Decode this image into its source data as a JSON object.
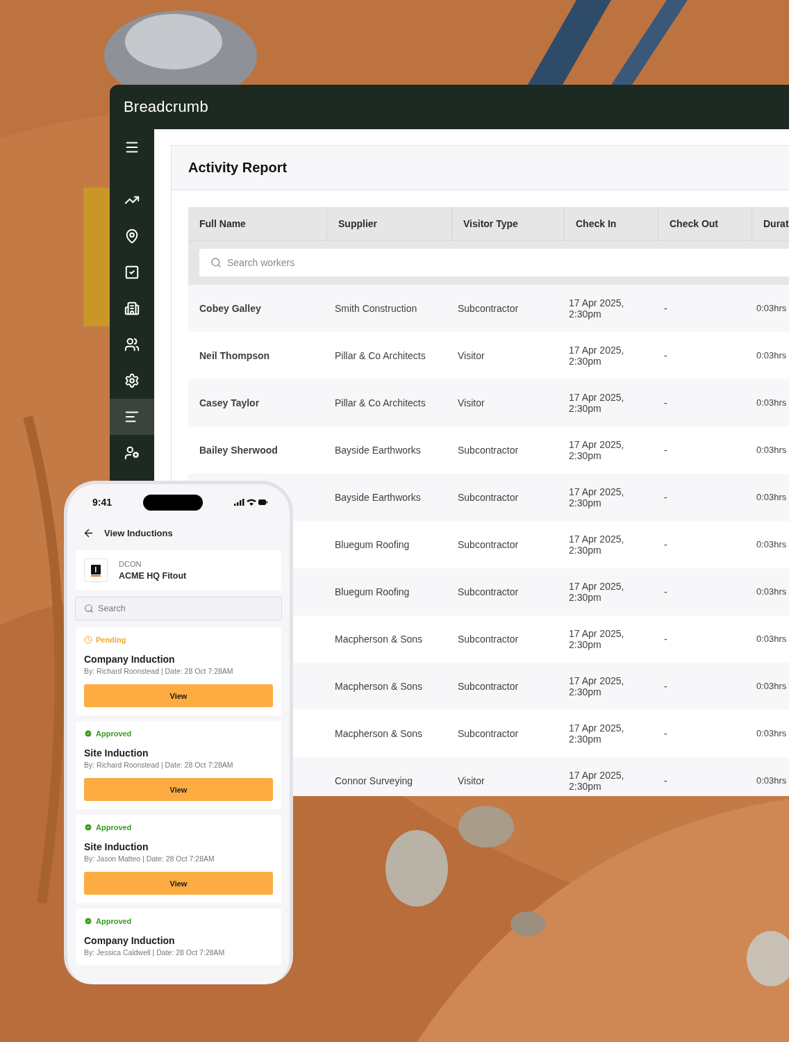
{
  "app": {
    "logo": "Breadcrumb"
  },
  "sidebar": {
    "items": [
      {
        "selected": false
      },
      {
        "selected": false
      },
      {
        "selected": false
      },
      {
        "selected": false
      },
      {
        "selected": false
      },
      {
        "selected": false
      },
      {
        "selected": false
      },
      {
        "selected": true
      },
      {
        "selected": false
      }
    ]
  },
  "report": {
    "title": "Activity Report",
    "columns": [
      "Full Name",
      "Supplier",
      "Visitor Type",
      "Check In",
      "Check Out",
      "Durat"
    ],
    "search": {
      "placeholder": "Search workers"
    },
    "rows": [
      {
        "name": "Cobey Galley",
        "supplier": "Smith Construction",
        "visitor_type": "Subcontractor",
        "check_in": "17 Apr 2025, 2:30pm",
        "check_out": "-",
        "duration": "0:03hrs"
      },
      {
        "name": "Neil Thompson",
        "supplier": "Pillar & Co Architects",
        "visitor_type": "Visitor",
        "check_in": "17 Apr 2025, 2:30pm",
        "check_out": "-",
        "duration": "0:03hrs"
      },
      {
        "name": "Casey Taylor",
        "supplier": "Pillar & Co Architects",
        "visitor_type": "Visitor",
        "check_in": "17 Apr 2025, 2:30pm",
        "check_out": "-",
        "duration": "0:03hrs"
      },
      {
        "name": "Bailey Sherwood",
        "supplier": "Bayside Earthworks",
        "visitor_type": "Subcontractor",
        "check_in": "17 Apr 2025, 2:30pm",
        "check_out": "-",
        "duration": "0:03hrs"
      },
      {
        "supplier": "Bayside Earthworks",
        "visitor_type": "Subcontractor",
        "check_in": "17 Apr 2025, 2:30pm",
        "check_out": "-",
        "duration": "0:03hrs"
      },
      {
        "supplier": "Bluegum Roofing",
        "visitor_type": "Subcontractor",
        "check_in": "17 Apr 2025, 2:30pm",
        "check_out": "-",
        "duration": "0:03hrs"
      },
      {
        "supplier": "Bluegum Roofing",
        "visitor_type": "Subcontractor",
        "check_in": "17 Apr 2025, 2:30pm",
        "check_out": "-",
        "duration": "0:03hrs"
      },
      {
        "supplier": "Macpherson & Sons",
        "visitor_type": "Subcontractor",
        "check_in": "17 Apr 2025, 2:30pm",
        "check_out": "-",
        "duration": "0:03hrs"
      },
      {
        "supplier": "Macpherson & Sons",
        "visitor_type": "Subcontractor",
        "check_in": "17 Apr 2025, 2:30pm",
        "check_out": "-",
        "duration": "0:03hrs"
      },
      {
        "supplier": "Macpherson & Sons",
        "visitor_type": "Subcontractor",
        "check_in": "17 Apr 2025, 2:30pm",
        "check_out": "-",
        "duration": "0:03hrs"
      },
      {
        "supplier": "Connor Surveying",
        "visitor_type": "Visitor",
        "check_in": "17 Apr 2025, 2:30pm",
        "check_out": "-",
        "duration": "0:03hrs"
      }
    ]
  },
  "phone": {
    "time": "9:41",
    "title": "View Inductions",
    "project": {
      "company": "DCON",
      "name": "ACME HQ Fitout"
    },
    "search": {
      "placeholder": "Search"
    },
    "inductions": [
      {
        "kind": "pending",
        "status_label": "Pending",
        "title": "Company Induction",
        "byline": "By: Richard Roonstead | Date: 28 Oct 7:28AM",
        "button": "View"
      },
      {
        "kind": "approved",
        "status_label": "Approved",
        "title": "Site Induction",
        "byline": "By: Richard Roonstead | Date: 28 Oct 7:28AM",
        "button": "View"
      },
      {
        "kind": "approved",
        "status_label": "Approved",
        "title": "Site Induction",
        "byline": "By: Jason Matteo | Date: 28 Oct 7:28AM",
        "button": "View"
      },
      {
        "kind": "approved",
        "status_label": "Approved",
        "title": "Company Induction",
        "byline": "By: Jessica Caldwell | Date: 28 Oct 7:28AM"
      }
    ]
  }
}
